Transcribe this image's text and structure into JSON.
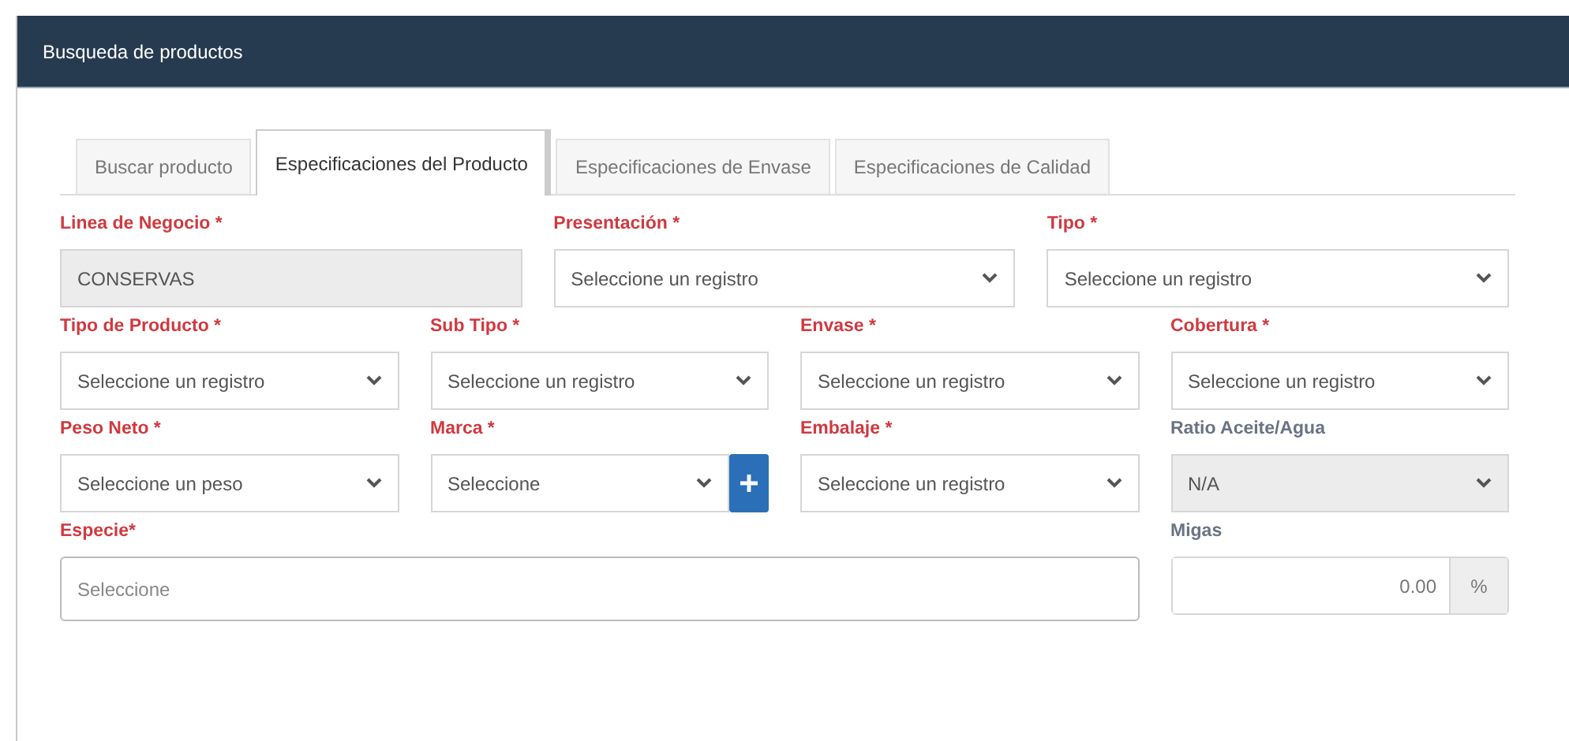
{
  "window": {
    "title": "Busqueda de productos"
  },
  "tabs": [
    {
      "label": "Buscar producto",
      "selected": false
    },
    {
      "label": "Especificaciones del Producto",
      "selected": true
    },
    {
      "label": "Especificaciones de Envase",
      "selected": false
    },
    {
      "label": "Especificaciones de Calidad",
      "selected": false
    }
  ],
  "form_rows": [
    [
      {
        "kind": "input",
        "label": "Linea de Negocio *",
        "required": true,
        "disabled": true,
        "value": "CONSERVAS"
      },
      {
        "kind": "select",
        "label": "Presentación *",
        "required": true,
        "disabled": false,
        "value": "Seleccione un registro"
      },
      {
        "kind": "select",
        "label": "Tipo *",
        "required": true,
        "disabled": false,
        "value": "Seleccione un registro"
      }
    ],
    [
      {
        "kind": "select",
        "label": "Tipo de Producto *",
        "required": true,
        "disabled": false,
        "value": "Seleccione un registro"
      },
      {
        "kind": "select",
        "label": "Sub Tipo *",
        "required": true,
        "disabled": false,
        "value": "Seleccione un registro"
      },
      {
        "kind": "select",
        "label": "Envase *",
        "required": true,
        "disabled": false,
        "value": "Seleccione un registro"
      },
      {
        "kind": "select",
        "label": "Cobertura *",
        "required": true,
        "disabled": false,
        "value": "Seleccione un registro"
      }
    ],
    [
      {
        "kind": "select",
        "label": "Peso Neto *",
        "required": true,
        "disabled": false,
        "value": "Seleccione un peso"
      },
      {
        "kind": "select-add",
        "label": "Marca *",
        "required": true,
        "disabled": false,
        "value": "Seleccione"
      },
      {
        "kind": "select",
        "label": "Embalaje *",
        "required": true,
        "disabled": false,
        "value": "Seleccione un registro"
      },
      {
        "kind": "select",
        "label": "Ratio Aceite/Agua",
        "required": false,
        "disabled": true,
        "value": "N/A"
      }
    ],
    [
      {
        "kind": "wide-input",
        "label": "Especie*",
        "required": true,
        "disabled": false,
        "placeholder": "Seleccione"
      },
      {
        "kind": "input-addon",
        "label": "Migas",
        "required": false,
        "disabled": false,
        "value": "0.00",
        "addon": "%"
      }
    ]
  ]
}
